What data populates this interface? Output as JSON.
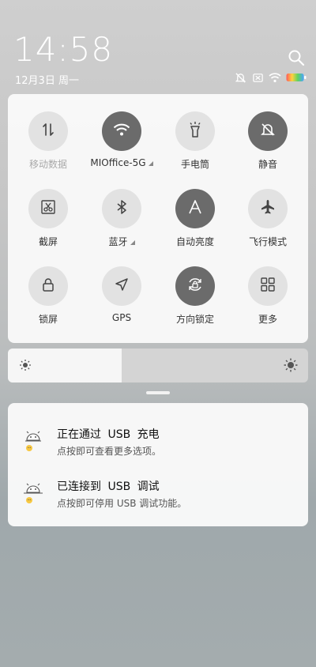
{
  "status": {
    "time": "14:58",
    "date": "12月3日 周一"
  },
  "tiles": [
    {
      "name": "mobile-data",
      "label": "移动数据",
      "active": false,
      "dim": true
    },
    {
      "name": "wifi",
      "label": "MIOffice-5G",
      "active": true,
      "dim": false,
      "submenu": true
    },
    {
      "name": "flashlight",
      "label": "手电筒",
      "active": false,
      "dim": false
    },
    {
      "name": "mute",
      "label": "静音",
      "active": true,
      "dim": false
    },
    {
      "name": "screenshot",
      "label": "截屏",
      "active": false,
      "dim": false
    },
    {
      "name": "bluetooth",
      "label": "蓝牙",
      "active": false,
      "dim": false,
      "submenu": true
    },
    {
      "name": "auto-brightness",
      "label": "自动亮度",
      "active": true,
      "dim": false
    },
    {
      "name": "airplane-mode",
      "label": "飞行模式",
      "active": false,
      "dim": false
    },
    {
      "name": "lock-screen",
      "label": "锁屏",
      "active": false,
      "dim": false
    },
    {
      "name": "gps",
      "label": "GPS",
      "active": false,
      "dim": false
    },
    {
      "name": "rotation-lock",
      "label": "方向锁定",
      "active": true,
      "dim": false
    },
    {
      "name": "more",
      "label": "更多",
      "active": false,
      "dim": false
    }
  ],
  "brightness": {
    "level": 0.38
  },
  "notifications": [
    {
      "title": "正在通过 USB 充电",
      "subtitle": "点按即可查看更多选项。"
    },
    {
      "title": "已连接到 USB 调试",
      "subtitle": "点按即可停用 USB 调试功能。"
    }
  ],
  "icons": {
    "status_bar": [
      "mute-icon",
      "no-sim-icon",
      "wifi-icon",
      "battery-icon"
    ]
  }
}
